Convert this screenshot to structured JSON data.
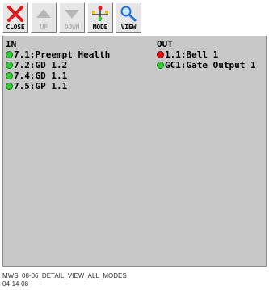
{
  "toolbar": {
    "buttons": [
      {
        "label": "CLOSE",
        "icon": "close-x-icon",
        "enabled": true
      },
      {
        "label": "UP",
        "icon": "up-arrow-icon",
        "enabled": false
      },
      {
        "label": "DOWN",
        "icon": "down-arrow-icon",
        "enabled": false
      },
      {
        "label": "MODE",
        "icon": "mode-signal-icon",
        "enabled": true
      },
      {
        "label": "VIEW",
        "icon": "magnifier-icon",
        "enabled": true
      }
    ]
  },
  "panel": {
    "in_header": "IN",
    "out_header": "OUT",
    "in_items": [
      {
        "text": "7.1:Preempt Health",
        "status": "green"
      },
      {
        "text": "7.2:GD 1.2",
        "status": "green"
      },
      {
        "text": "7.4:GD 1.1",
        "status": "green"
      },
      {
        "text": "7.5:GP 1.1",
        "status": "green"
      }
    ],
    "out_items": [
      {
        "text": "1.1:Bell 1",
        "status": "red"
      },
      {
        "text": "GC1:Gate Output 1",
        "status": "green"
      }
    ]
  },
  "caption": {
    "line1": "MWS_08-06_DETAIL_VIEW_ALL_MODES",
    "line2": "04-14-08"
  },
  "colors": {
    "panel_bg": "#c8c8c8",
    "status_green": "#2fcf2f",
    "status_red": "#e01414",
    "close_red": "#e01a1a"
  }
}
